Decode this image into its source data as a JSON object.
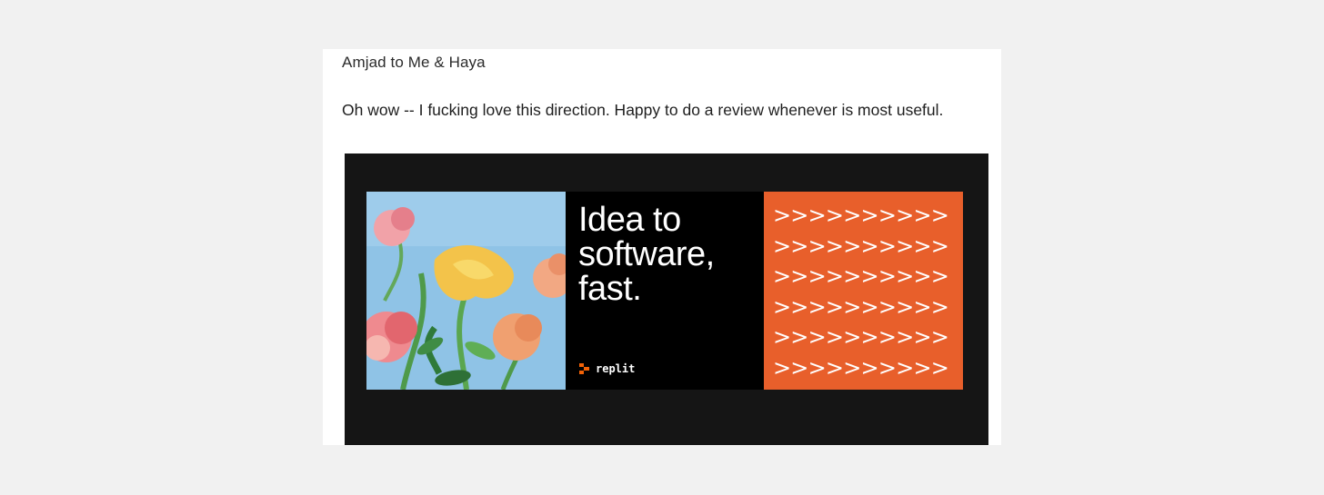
{
  "email": {
    "sender_line": "Amjad to Me & Haya",
    "body": "Oh wow -- I fucking love this direction. Happy to do a review whenever is most useful."
  },
  "ad": {
    "headline": "Idea to\nsoftware,\nfast.",
    "brand": "replit",
    "arrow_rows": [
      ">>>>>>>>>>",
      ">>>>>>>>>>",
      ">>>>>>>>>>",
      ">>>>>>>>>>",
      ">>>>>>>>>>",
      ">>>>>>>>>>"
    ],
    "art_icon": "flower-painting-icon",
    "logo_icon": "replit-logo-icon",
    "colors": {
      "frame": "#151515",
      "accent": "#e85f2b",
      "sky": "#8fc3e6"
    }
  }
}
